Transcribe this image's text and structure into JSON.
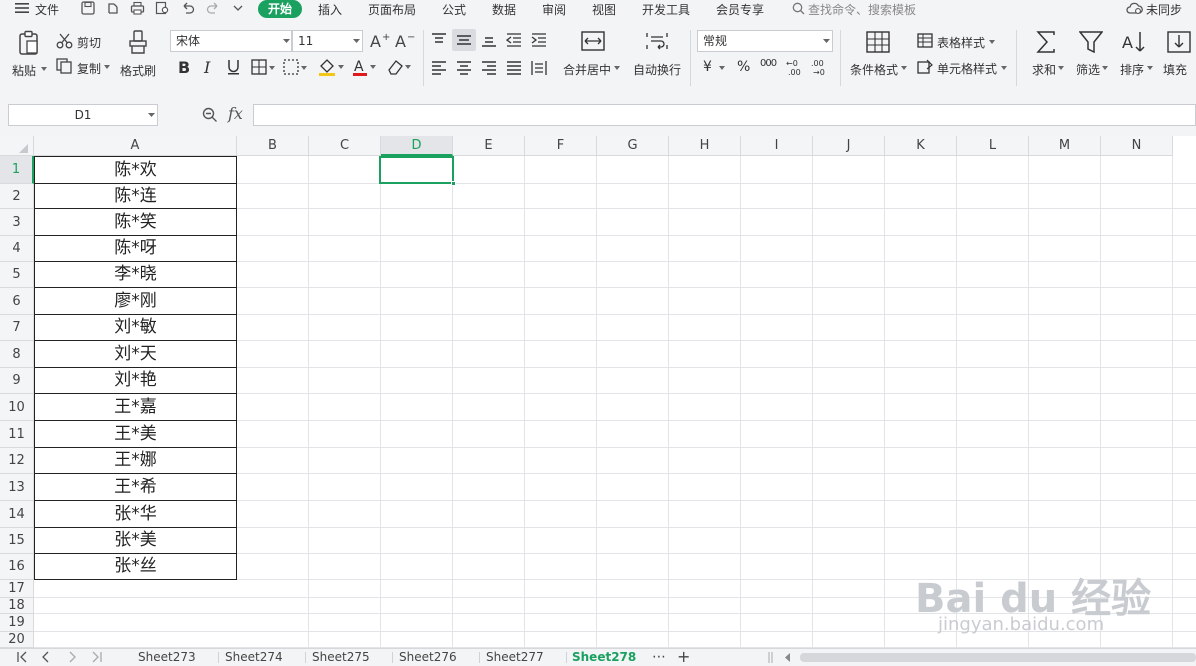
{
  "menubar": {
    "file_label": "文件",
    "tabs": [
      "开始",
      "插入",
      "页面布局",
      "公式",
      "数据",
      "审阅",
      "视图",
      "开发工具",
      "会员专享"
    ],
    "active_tab": "开始",
    "search_placeholder": "查找命令、搜索模板",
    "sync_label": "未同步"
  },
  "ribbon": {
    "paste": "粘贴",
    "cut": "剪切",
    "copy": "复制",
    "format_painter": "格式刷",
    "font_name": "宋体",
    "font_size": "11",
    "merge_center": "合并居中",
    "wrap_text": "自动换行",
    "number_format": "常规",
    "currency_symbol": "¥",
    "percent_symbol": "%",
    "thousands_symbol": "000",
    "conditional_format": "条件格式",
    "table_style": "表格样式",
    "cell_style": "单元格样式",
    "sum": "求和",
    "filter": "筛选",
    "sort": "排序",
    "fill": "填充"
  },
  "formula_bar": {
    "name_box": "D1",
    "fx": "fx",
    "formula": ""
  },
  "grid": {
    "columns": [
      "A",
      "B",
      "C",
      "D",
      "E",
      "F",
      "G",
      "H",
      "I",
      "J",
      "K",
      "L",
      "M",
      "N"
    ],
    "rows": [
      "1",
      "2",
      "3",
      "4",
      "5",
      "6",
      "7",
      "8",
      "9",
      "10",
      "11",
      "12",
      "13",
      "14",
      "15",
      "16",
      "17",
      "18",
      "19",
      "20"
    ],
    "selected_cell": "D1",
    "column_a_values": [
      "陈*欢",
      "陈*连",
      "陈*笑",
      "陈*呀",
      "李*晓",
      "廖*刚",
      "刘*敏",
      "刘*天",
      "刘*艳",
      "王*嘉",
      "王*美",
      "王*娜",
      "王*希",
      "张*华",
      "张*美",
      "张*丝"
    ]
  },
  "sheets": {
    "tabs": [
      "Sheet273",
      "Sheet274",
      "Sheet275",
      "Sheet276",
      "Sheet277",
      "Sheet278"
    ],
    "active": "Sheet278",
    "more": "⋯",
    "add": "+"
  },
  "watermark": {
    "brand": "Bai du 经验",
    "url": "jingyan.baidu.com"
  },
  "colors": {
    "accent": "#1aa160",
    "selection": "#1aa160"
  }
}
